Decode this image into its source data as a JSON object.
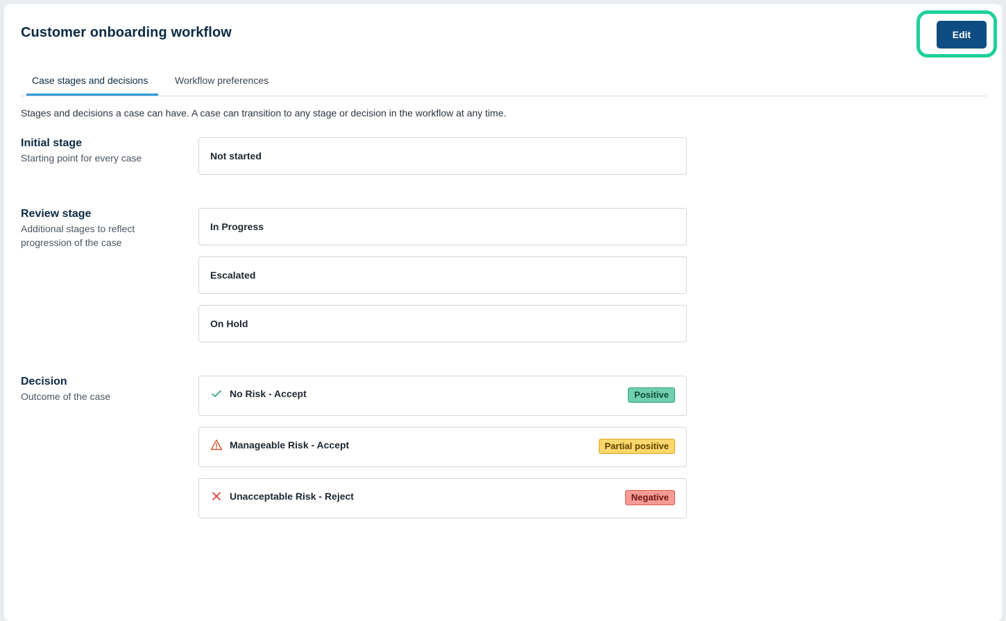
{
  "page": {
    "title": "Customer onboarding workflow",
    "edit_label": "Edit",
    "intro": "Stages and decisions a case can have. A case can transition to any stage or decision in the workflow at any time."
  },
  "tabs": [
    {
      "label": "Case stages and decisions",
      "active": true
    },
    {
      "label": "Workflow preferences",
      "active": false
    }
  ],
  "initial_stage": {
    "title": "Initial stage",
    "description": "Starting point for every case",
    "items": [
      "Not started"
    ]
  },
  "review_stage": {
    "title": "Review stage",
    "description": "Additional stages to reflect progression of the case",
    "items": [
      "In Progress",
      "Escalated",
      "On Hold"
    ]
  },
  "decision": {
    "title": "Decision",
    "description": "Outcome of the case",
    "items": [
      {
        "label": "No Risk - Accept",
        "icon": "check-icon",
        "badge": "Positive",
        "color": "#2e9e7a"
      },
      {
        "label": "Manageable Risk - Accept",
        "icon": "warning-triangle-icon",
        "badge": "Partial positive",
        "color": "#d9532c"
      },
      {
        "label": "Unacceptable Risk - Reject",
        "icon": "x-mark-icon",
        "badge": "Negative",
        "color": "#d93a32"
      }
    ]
  },
  "colors": {
    "primary": "#0f4c81",
    "highlight": "#1fd09a",
    "tab_indicator": "#2f9ad8",
    "heading": "#0b2a44"
  }
}
